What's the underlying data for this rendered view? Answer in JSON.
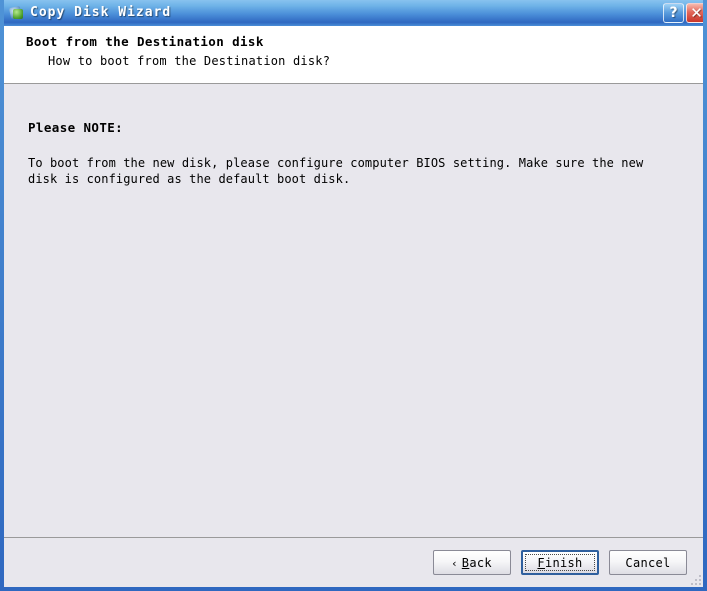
{
  "window": {
    "title": "Copy Disk Wizard",
    "icon": "disk-copy-icon",
    "accent_color": "#2f68c0",
    "body_background": "#e8e7ed",
    "header_background": "#ffffff",
    "controls": [
      {
        "name": "help-button",
        "label": "?",
        "color": "#2f6fc4"
      },
      {
        "name": "close-button",
        "label": "✕",
        "color": "#c9362a"
      }
    ]
  },
  "header": {
    "title": "Boot from the Destination disk",
    "subtitle": "How to boot from the Destination disk?"
  },
  "content": {
    "note_title": "Please NOTE:",
    "note_body": "To boot from the new disk, please configure computer BIOS setting. Make sure the new disk is configured as the default boot disk."
  },
  "footer": {
    "buttons": [
      {
        "name": "back-button",
        "prefix": "‹",
        "mnemonic": "B",
        "rest": "ack",
        "label": "< Back",
        "default": false
      },
      {
        "name": "finish-button",
        "prefix": "",
        "mnemonic": "F",
        "rest": "inish",
        "label": "Finish",
        "default": true
      },
      {
        "name": "cancel-button",
        "prefix": "",
        "mnemonic": "",
        "rest": "Cancel",
        "label": "Cancel",
        "default": false
      }
    ]
  }
}
